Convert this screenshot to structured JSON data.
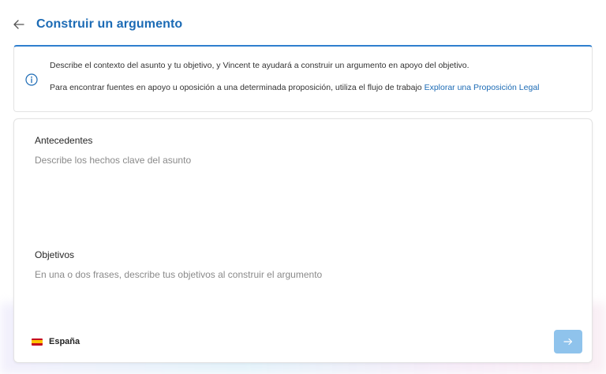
{
  "header": {
    "title": "Construir un argumento"
  },
  "info": {
    "line1": "Describe el contexto del asunto y tu objetivo, y Vincent te ayudará a construir un argumento en apoyo del objetivo.",
    "line2_prefix": "Para encontrar fuentes en apoyo u oposición a una determinada proposición, utiliza el flujo de trabajo ",
    "line2_link": "Explorar una Proposición Legal"
  },
  "form": {
    "background_label": "Antecedentes",
    "background_placeholder": "Describe los hechos clave del asunto",
    "objectives_label": "Objetivos",
    "objectives_placeholder": "En una o dos frases, describe tus objetivos al construir el argumento",
    "country": "España"
  },
  "icons": {
    "back": "arrow-left-icon",
    "info": "info-icon",
    "flag": "spain-flag-icon",
    "submit": "arrow-right-icon"
  },
  "colors": {
    "accent": "#1c6bb5",
    "submit_disabled": "#8fc3ec"
  }
}
